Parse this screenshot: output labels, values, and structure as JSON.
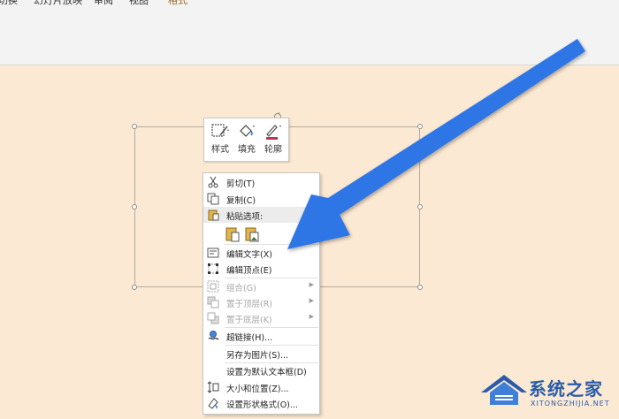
{
  "ribbon": {
    "tabs": [
      {
        "label": "切换",
        "active": false
      },
      {
        "label": "幻灯片放映",
        "active": false
      },
      {
        "label": "审阅",
        "active": false
      },
      {
        "label": "视图",
        "active": false
      },
      {
        "label": "格式",
        "active": true
      }
    ]
  },
  "minibar": {
    "style_label": "样式",
    "fill_label": "填充",
    "outline_label": "轮廓"
  },
  "context_menu": {
    "cut": "剪切(T)",
    "copy": "复制(C)",
    "paste_options": "粘贴选项:",
    "edit_text": "编辑文字(X)",
    "edit_points": "编辑顶点(E)",
    "group": "组合(G)",
    "bring_front": "置于顶层(R)",
    "send_back": "置于底层(K)",
    "hyperlink": "超链接(H)...",
    "save_as_picture": "另存为图片(S)...",
    "set_default_textbox": "设置为默认文本框(D)",
    "size_position": "大小和位置(Z)...",
    "format_shape": "设置形状格式(O)..."
  },
  "watermark": {
    "title": "系统之家",
    "subtitle": "XITONGZHIJIA.NET"
  },
  "colors": {
    "arrow": "#2f74e6",
    "canvas": "#fbe9d3",
    "outline_swatch": "#c0334f"
  }
}
